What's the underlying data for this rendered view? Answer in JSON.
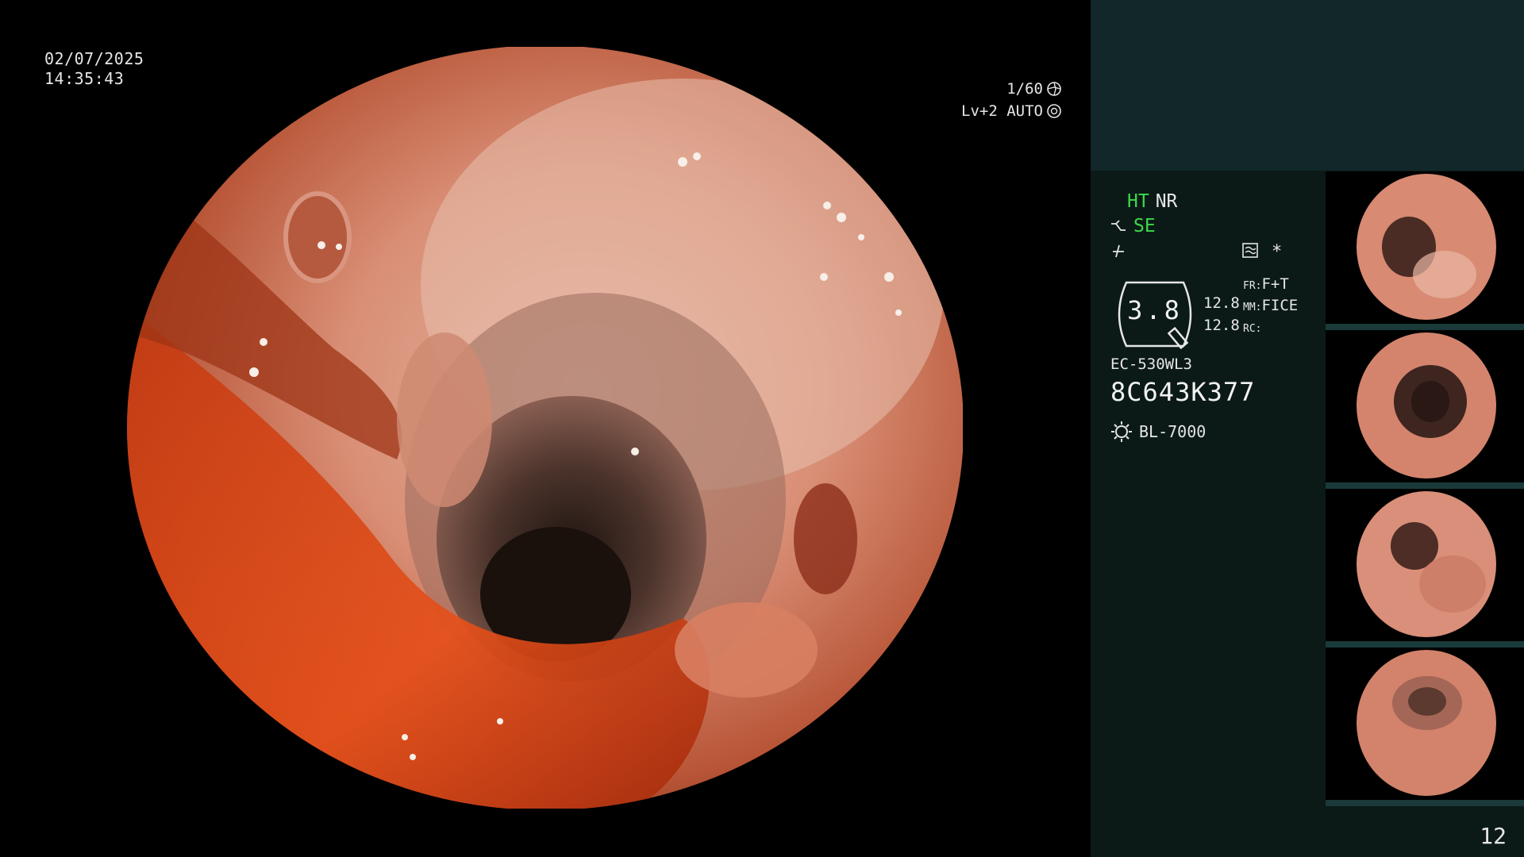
{
  "overlay": {
    "date": "02/07/2025",
    "time": "14:35:43",
    "shutter": "1/60",
    "iris": "Lv+2 AUTO"
  },
  "status": {
    "ht": "HT",
    "nr": "NR",
    "se": "SE",
    "fr_label": "FR:",
    "fr_value": "F+T",
    "mm_label": "MM:",
    "mm_value": "FICE",
    "rc_label": "RC:",
    "brightness": "3.8",
    "mm_top": "12.8",
    "mm_bottom": "12.8",
    "star": "*"
  },
  "device": {
    "scope_model": "EC-530WL3",
    "serial": "8C643K377",
    "light_source": "BL-7000"
  },
  "page_number": "12",
  "thumbnails": [
    {
      "name": "thumb-1"
    },
    {
      "name": "thumb-2"
    },
    {
      "name": "thumb-3"
    },
    {
      "name": "thumb-4"
    }
  ],
  "colors": {
    "accent_green": "#3bd94a",
    "panel_bg": "#0b1a17",
    "panel_top": "#11272a"
  }
}
